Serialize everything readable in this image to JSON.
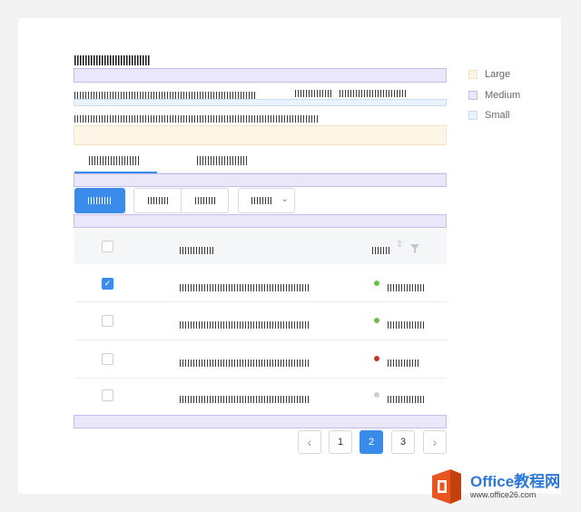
{
  "legend": {
    "large": {
      "label": "Large",
      "color": "#fdf5e6"
    },
    "medium": {
      "label": "Medium",
      "color": "#ebe7fb"
    },
    "small": {
      "label": "Small",
      "color": "#e9f3fd"
    }
  },
  "table": {
    "rows": [
      {
        "checked": true,
        "status_color": "#6cc04a"
      },
      {
        "checked": false,
        "status_color": "#6cc04a"
      },
      {
        "checked": false,
        "status_color": "#c0392b"
      },
      {
        "checked": false,
        "status_color": "#cfcfcf"
      }
    ],
    "check_mark": "✓",
    "sort_icon": "⇕",
    "filter_icon": "filter-icon"
  },
  "pagination": {
    "prev": "‹",
    "pages": [
      "1",
      "2",
      "3"
    ],
    "active": "2",
    "next": "›"
  },
  "watermark": {
    "brand_text": "Office教程网",
    "url_text": "www.office26.com"
  },
  "dropdown": {
    "chevron": "⌄"
  }
}
